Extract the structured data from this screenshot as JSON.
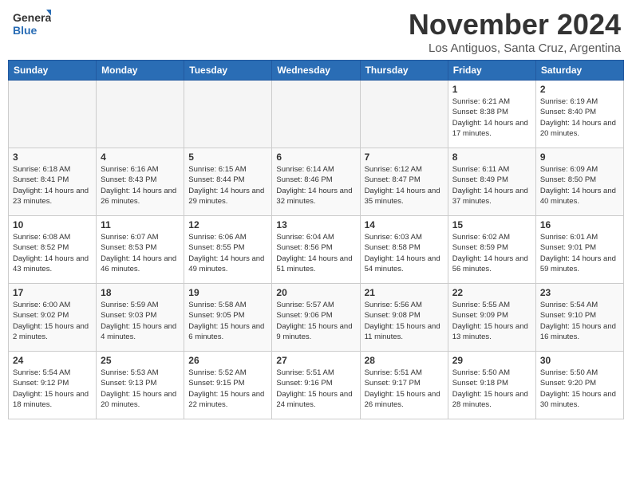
{
  "header": {
    "logo_general": "General",
    "logo_blue": "Blue",
    "month": "November 2024",
    "location": "Los Antiguos, Santa Cruz, Argentina"
  },
  "weekdays": [
    "Sunday",
    "Monday",
    "Tuesday",
    "Wednesday",
    "Thursday",
    "Friday",
    "Saturday"
  ],
  "weeks": [
    [
      {
        "day": "",
        "info": ""
      },
      {
        "day": "",
        "info": ""
      },
      {
        "day": "",
        "info": ""
      },
      {
        "day": "",
        "info": ""
      },
      {
        "day": "",
        "info": ""
      },
      {
        "day": "1",
        "info": "Sunrise: 6:21 AM\nSunset: 8:38 PM\nDaylight: 14 hours and 17 minutes."
      },
      {
        "day": "2",
        "info": "Sunrise: 6:19 AM\nSunset: 8:40 PM\nDaylight: 14 hours and 20 minutes."
      }
    ],
    [
      {
        "day": "3",
        "info": "Sunrise: 6:18 AM\nSunset: 8:41 PM\nDaylight: 14 hours and 23 minutes."
      },
      {
        "day": "4",
        "info": "Sunrise: 6:16 AM\nSunset: 8:43 PM\nDaylight: 14 hours and 26 minutes."
      },
      {
        "day": "5",
        "info": "Sunrise: 6:15 AM\nSunset: 8:44 PM\nDaylight: 14 hours and 29 minutes."
      },
      {
        "day": "6",
        "info": "Sunrise: 6:14 AM\nSunset: 8:46 PM\nDaylight: 14 hours and 32 minutes."
      },
      {
        "day": "7",
        "info": "Sunrise: 6:12 AM\nSunset: 8:47 PM\nDaylight: 14 hours and 35 minutes."
      },
      {
        "day": "8",
        "info": "Sunrise: 6:11 AM\nSunset: 8:49 PM\nDaylight: 14 hours and 37 minutes."
      },
      {
        "day": "9",
        "info": "Sunrise: 6:09 AM\nSunset: 8:50 PM\nDaylight: 14 hours and 40 minutes."
      }
    ],
    [
      {
        "day": "10",
        "info": "Sunrise: 6:08 AM\nSunset: 8:52 PM\nDaylight: 14 hours and 43 minutes."
      },
      {
        "day": "11",
        "info": "Sunrise: 6:07 AM\nSunset: 8:53 PM\nDaylight: 14 hours and 46 minutes."
      },
      {
        "day": "12",
        "info": "Sunrise: 6:06 AM\nSunset: 8:55 PM\nDaylight: 14 hours and 49 minutes."
      },
      {
        "day": "13",
        "info": "Sunrise: 6:04 AM\nSunset: 8:56 PM\nDaylight: 14 hours and 51 minutes."
      },
      {
        "day": "14",
        "info": "Sunrise: 6:03 AM\nSunset: 8:58 PM\nDaylight: 14 hours and 54 minutes."
      },
      {
        "day": "15",
        "info": "Sunrise: 6:02 AM\nSunset: 8:59 PM\nDaylight: 14 hours and 56 minutes."
      },
      {
        "day": "16",
        "info": "Sunrise: 6:01 AM\nSunset: 9:01 PM\nDaylight: 14 hours and 59 minutes."
      }
    ],
    [
      {
        "day": "17",
        "info": "Sunrise: 6:00 AM\nSunset: 9:02 PM\nDaylight: 15 hours and 2 minutes."
      },
      {
        "day": "18",
        "info": "Sunrise: 5:59 AM\nSunset: 9:03 PM\nDaylight: 15 hours and 4 minutes."
      },
      {
        "day": "19",
        "info": "Sunrise: 5:58 AM\nSunset: 9:05 PM\nDaylight: 15 hours and 6 minutes."
      },
      {
        "day": "20",
        "info": "Sunrise: 5:57 AM\nSunset: 9:06 PM\nDaylight: 15 hours and 9 minutes."
      },
      {
        "day": "21",
        "info": "Sunrise: 5:56 AM\nSunset: 9:08 PM\nDaylight: 15 hours and 11 minutes."
      },
      {
        "day": "22",
        "info": "Sunrise: 5:55 AM\nSunset: 9:09 PM\nDaylight: 15 hours and 13 minutes."
      },
      {
        "day": "23",
        "info": "Sunrise: 5:54 AM\nSunset: 9:10 PM\nDaylight: 15 hours and 16 minutes."
      }
    ],
    [
      {
        "day": "24",
        "info": "Sunrise: 5:54 AM\nSunset: 9:12 PM\nDaylight: 15 hours and 18 minutes."
      },
      {
        "day": "25",
        "info": "Sunrise: 5:53 AM\nSunset: 9:13 PM\nDaylight: 15 hours and 20 minutes."
      },
      {
        "day": "26",
        "info": "Sunrise: 5:52 AM\nSunset: 9:15 PM\nDaylight: 15 hours and 22 minutes."
      },
      {
        "day": "27",
        "info": "Sunrise: 5:51 AM\nSunset: 9:16 PM\nDaylight: 15 hours and 24 minutes."
      },
      {
        "day": "28",
        "info": "Sunrise: 5:51 AM\nSunset: 9:17 PM\nDaylight: 15 hours and 26 minutes."
      },
      {
        "day": "29",
        "info": "Sunrise: 5:50 AM\nSunset: 9:18 PM\nDaylight: 15 hours and 28 minutes."
      },
      {
        "day": "30",
        "info": "Sunrise: 5:50 AM\nSunset: 9:20 PM\nDaylight: 15 hours and 30 minutes."
      }
    ]
  ]
}
